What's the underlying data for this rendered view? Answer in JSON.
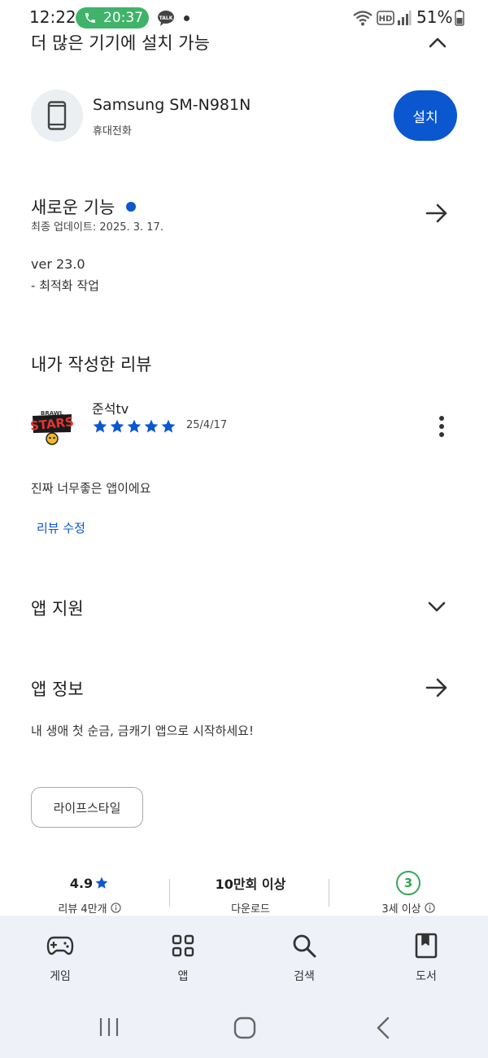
{
  "status_bar": {
    "time": "12:22",
    "call_time": "20:37",
    "battery": "51%",
    "icons": [
      "phone-icon",
      "talk-icon",
      "wifi-icon",
      "hd-icon",
      "signal-icon",
      "battery-icon"
    ]
  },
  "more_devices": {
    "title": "더 많은 기기에 설치 가능",
    "device_name": "Samsung SM-N981N",
    "device_type": "휴대전화",
    "install_label": "설치"
  },
  "whats_new": {
    "title": "새로운 기능",
    "last_updated": "최종 업데이트: 2025. 3. 17.",
    "version": "ver 23.0",
    "changelog": "- 최적화 작업"
  },
  "my_review": {
    "title": "내가 작성한 리뷰",
    "reviewer": "준석tv",
    "rating": 5,
    "date": "25/4/17",
    "text": "진짜 너무좋은 앱이에요",
    "edit_label": "리뷰 수정"
  },
  "app_support": {
    "title": "앱 지원"
  },
  "about": {
    "title": "앱 정보",
    "description": "내 생애 첫 순금, 금캐기 앱으로 시작하세요!",
    "category": "라이프스타일"
  },
  "stats": {
    "rating_value": "4.9",
    "rating_label": "리뷰 4만개",
    "downloads_value": "10만회 이상",
    "downloads_label": "다운로드",
    "age_value": "3",
    "age_label": "3세 이상"
  },
  "bottom_nav": {
    "games": "게임",
    "apps": "앱",
    "search": "검색",
    "books": "도서"
  },
  "colors": {
    "accent": "#0b57d0",
    "call_green": "#3fb36a",
    "age_green": "#34a853",
    "nav_bg": "#eef2f8"
  }
}
